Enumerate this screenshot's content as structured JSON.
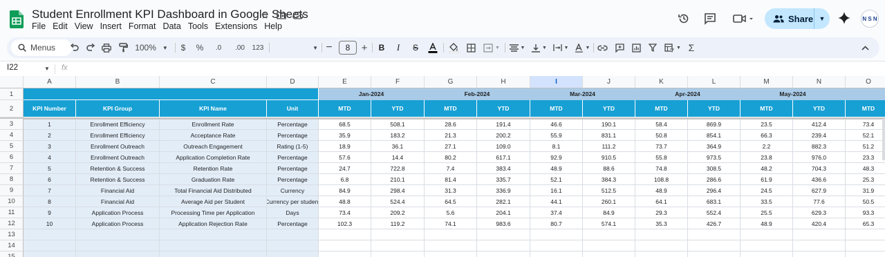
{
  "title": "Student Enrollment KPI Dashboard in Google Sheets",
  "menu": [
    "File",
    "Edit",
    "View",
    "Insert",
    "Format",
    "Data",
    "Tools",
    "Extensions",
    "Help"
  ],
  "share_label": "Share",
  "avatar_text": "N S N",
  "toolbar": {
    "search_label": "Menus",
    "zoom": "100%",
    "currency": "$",
    "percent": "%",
    "dec_less": ".0",
    "dec_more": ".00",
    "number_format": "123",
    "font_size": "8"
  },
  "name_box": "I22",
  "fx": "fx",
  "columns": [
    "A",
    "B",
    "C",
    "D",
    "E",
    "F",
    "G",
    "H",
    "I",
    "J",
    "K",
    "L",
    "M",
    "N",
    "O"
  ],
  "selected_column": "I",
  "row_numbers": [
    "1",
    "2",
    "3",
    "4",
    "5",
    "6",
    "7",
    "8",
    "9",
    "10",
    "11",
    "12",
    "13",
    "14",
    "15"
  ],
  "months": [
    "Jan-2024",
    "Feb-2024",
    "Mar-2024",
    "Apr-2024",
    "May-2024"
  ],
  "headers": [
    "KPI Number",
    "KPI Group",
    "KPI Name",
    "Unit"
  ],
  "sub_headers": [
    "MTD",
    "YTD",
    "MTD",
    "YTD",
    "MTD",
    "YTD",
    "MTD",
    "YTD",
    "MTD",
    "YTD",
    "MTD"
  ],
  "rows": [
    [
      "1",
      "Enrollment Efficiency",
      "Enrollment Rate",
      "Percentage",
      "68.5",
      "508.1",
      "28.6",
      "191.4",
      "46.6",
      "190.1",
      "58.4",
      "869.9",
      "23.5",
      "412.4",
      "73.4"
    ],
    [
      "2",
      "Enrollment Efficiency",
      "Acceptance Rate",
      "Percentage",
      "35.9",
      "183.2",
      "21.3",
      "200.2",
      "55.9",
      "831.1",
      "50.8",
      "854.1",
      "66.3",
      "239.4",
      "52.1"
    ],
    [
      "3",
      "Enrollment Outreach",
      "Outreach Engagement",
      "Rating (1-5)",
      "18.9",
      "36.1",
      "27.1",
      "109.0",
      "8.1",
      "111.2",
      "73.7",
      "364.9",
      "2.2",
      "882.3",
      "51.2"
    ],
    [
      "4",
      "Enrollment Outreach",
      "Application Completion Rate",
      "Percentage",
      "57.6",
      "14.4",
      "80.2",
      "617.1",
      "92.9",
      "910.5",
      "55.8",
      "973.5",
      "23.8",
      "976.0",
      "23.3"
    ],
    [
      "5",
      "Retention & Success",
      "Retention Rate",
      "Percentage",
      "24.7",
      "722.8",
      "7.4",
      "383.4",
      "48.9",
      "88.6",
      "74.8",
      "308.5",
      "48.2",
      "704.3",
      "48.3"
    ],
    [
      "6",
      "Retention & Success",
      "Graduation Rate",
      "Percentage",
      "6.8",
      "210.1",
      "81.4",
      "335.7",
      "52.1",
      "384.3",
      "108.8",
      "286.6",
      "61.9",
      "436.6",
      "25.3"
    ],
    [
      "7",
      "Financial Aid",
      "Total Financial Aid Distributed",
      "Currency",
      "84.9",
      "298.4",
      "31.3",
      "336.9",
      "16.1",
      "512.5",
      "48.9",
      "296.4",
      "24.5",
      "627.9",
      "31.9"
    ],
    [
      "8",
      "Financial Aid",
      "Average Aid per Student",
      "Currency per student",
      "48.8",
      "524.4",
      "64.5",
      "282.1",
      "44.1",
      "260.1",
      "64.1",
      "683.1",
      "33.5",
      "77.6",
      "50.5"
    ],
    [
      "9",
      "Application Process",
      "Processing Time per Application",
      "Days",
      "73.4",
      "209.2",
      "5.6",
      "204.1",
      "37.4",
      "84.9",
      "29.3",
      "552.4",
      "25.5",
      "629.3",
      "93.3"
    ],
    [
      "10",
      "Application Process",
      "Application Rejection Rate",
      "Percentage",
      "102.3",
      "119.2",
      "74.1",
      "983.6",
      "80.7",
      "574.1",
      "35.3",
      "426.7",
      "48.9",
      "420.4",
      "65.3"
    ]
  ],
  "colors": {
    "header_dark": "#17a0d4",
    "header_light": "#a9cbe8",
    "body_left": "#e3edf8",
    "share_bg": "#c2e7ff",
    "sheets_green": "#0f9d58"
  }
}
